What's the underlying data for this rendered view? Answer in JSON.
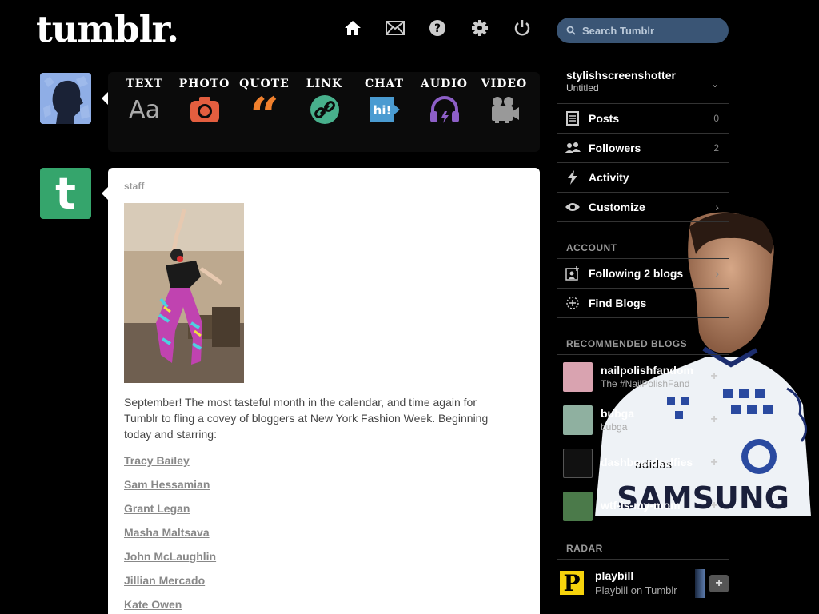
{
  "header": {
    "logo": "tumblr.",
    "nav": [
      {
        "name": "home",
        "icon": "home-icon"
      },
      {
        "name": "inbox",
        "icon": "mail-icon"
      },
      {
        "name": "help",
        "icon": "help-icon"
      },
      {
        "name": "settings",
        "icon": "gear-icon"
      },
      {
        "name": "logout",
        "icon": "power-icon"
      }
    ],
    "search_placeholder": "Search Tumblr"
  },
  "post_types": [
    {
      "label": "TEXT",
      "icon": "text-icon",
      "color": "#bbbbbb"
    },
    {
      "label": "PHOTO",
      "icon": "camera-icon",
      "color": "#e35e3f"
    },
    {
      "label": "QUOTE",
      "icon": "quote-icon",
      "color": "#f0802d"
    },
    {
      "label": "LINK",
      "icon": "link-icon",
      "color": "#48b08c"
    },
    {
      "label": "CHAT",
      "icon": "chat-icon",
      "color": "#4a9bd1"
    },
    {
      "label": "AUDIO",
      "icon": "headphones-icon",
      "color": "#8d5fc7"
    },
    {
      "label": "VIDEO",
      "icon": "video-camera-icon",
      "color": "#999999"
    }
  ],
  "post": {
    "author": "staff",
    "body": "September! The most tasteful month in the calendar, and time again for Tumblr to fling a covey of bloggers at New York Fashion Week. Beginning today and starring:",
    "links": [
      "Tracy Bailey",
      "Sam Hessamian",
      "Grant Legan",
      "Masha Maltsava",
      "John McLaughlin",
      "Jillian Mercado",
      "Kate Owen"
    ]
  },
  "sidebar": {
    "blog_name": "stylishscreenshotter",
    "blog_title": "Untitled",
    "items": [
      {
        "label": "Posts",
        "count": "0",
        "icon": "posts-icon"
      },
      {
        "label": "Followers",
        "count": "2",
        "icon": "followers-icon"
      },
      {
        "label": "Activity",
        "count": "",
        "icon": "lightning-icon"
      },
      {
        "label": "Customize",
        "count": "",
        "icon": "eye-icon"
      }
    ],
    "account_heading": "ACCOUNT",
    "account_items": [
      {
        "label": "Following 2 blogs",
        "icon": "following-icon"
      },
      {
        "label": "Find Blogs",
        "icon": "find-blogs-icon"
      }
    ],
    "recommended_heading": "RECOMMENDED BLOGS",
    "recommended": [
      {
        "name": "nailpolishfandom",
        "sub": "The #NailPolishFand",
        "thumb_color": "#d9a3b0"
      },
      {
        "name": "bubga",
        "sub": "bubga",
        "thumb_color": "#8fb0a0"
      },
      {
        "name": "dashboardselfies",
        "sub": "",
        "thumb_color": "#111111"
      },
      {
        "name": "wtf-is-my-mom",
        "sub": "",
        "thumb_color": "#4b7a4a"
      }
    ],
    "radar_heading": "RADAR",
    "radar": {
      "name": "playbill",
      "sub": "Playbill on Tumblr",
      "thumb_letter": "P"
    }
  }
}
